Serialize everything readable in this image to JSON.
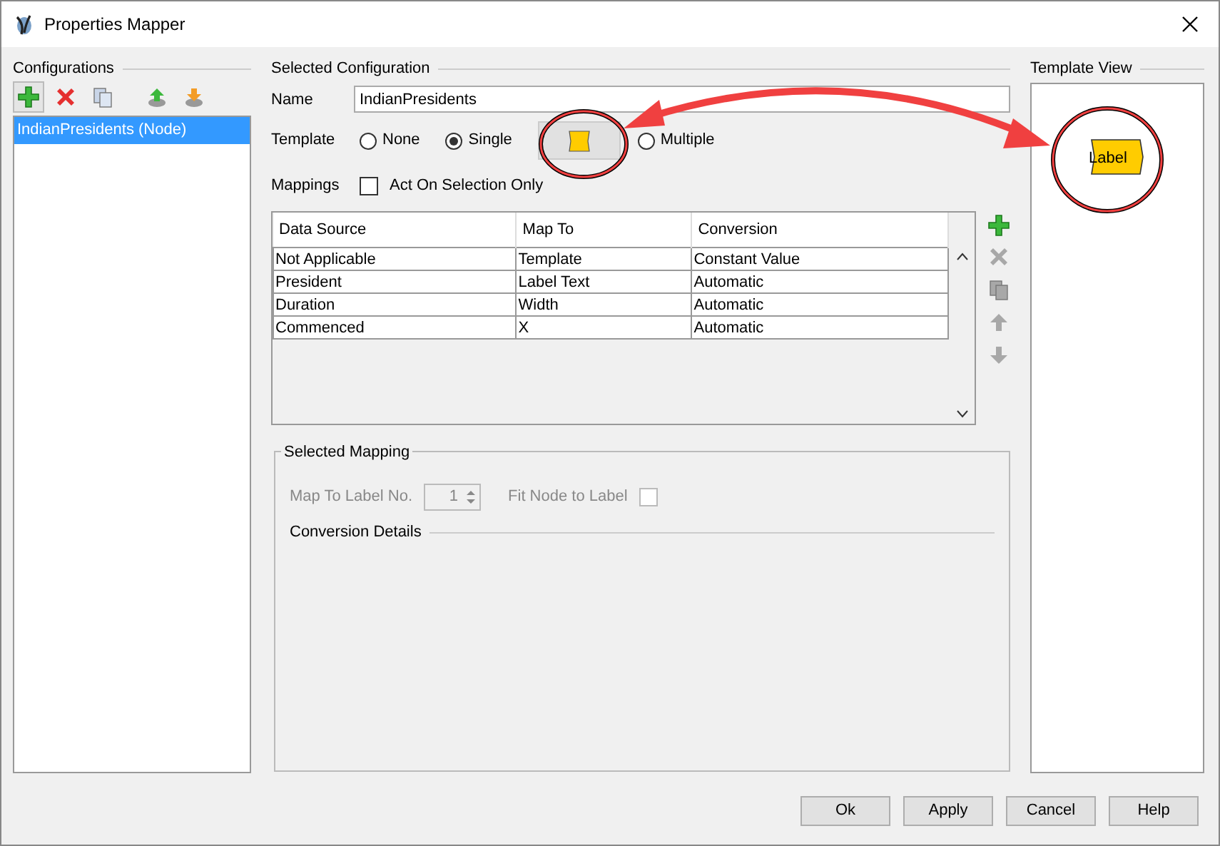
{
  "window": {
    "title": "Properties Mapper"
  },
  "configurations": {
    "title": "Configurations",
    "toolbar": [
      {
        "kind": "add",
        "hover": true
      },
      {
        "kind": "delete",
        "hover": false
      },
      {
        "kind": "copy",
        "hover": false
      },
      {
        "kind": "import",
        "hover": false
      },
      {
        "kind": "export",
        "hover": false
      }
    ],
    "items": [
      {
        "label": "IndianPresidents (Node)",
        "selected": true
      }
    ]
  },
  "selected_configuration": {
    "title": "Selected Configuration",
    "name_label": "Name",
    "name_value": "IndianPresidents",
    "template_label": "Template",
    "template_options": [
      {
        "label": "None",
        "selected": false
      },
      {
        "label": "Single",
        "selected": true
      },
      {
        "label": "Multiple",
        "selected": false
      }
    ],
    "mappings_label": "Mappings",
    "act_on_selection": {
      "label": "Act On Selection Only",
      "checked": false
    },
    "table": {
      "columns": [
        "Data Source",
        "Map To",
        "Conversion"
      ],
      "rows": [
        [
          "Not Applicable",
          "Template",
          "Constant Value"
        ],
        [
          "President",
          "Label Text",
          "Automatic"
        ],
        [
          "Duration",
          "Width",
          "Automatic"
        ],
        [
          "Commenced",
          "X",
          "Automatic"
        ]
      ]
    },
    "side_buttons": [
      {
        "kind": "add",
        "disabled": false
      },
      {
        "kind": "delete",
        "disabled": true
      },
      {
        "kind": "copy",
        "disabled": true
      },
      {
        "kind": "up",
        "disabled": true
      },
      {
        "kind": "down",
        "disabled": true
      }
    ]
  },
  "selected_mapping": {
    "title": "Selected Mapping",
    "disabled": true,
    "label_no_label": "Map To Label No.",
    "label_no_value": "1",
    "fit_label": "Fit Node to Label",
    "fit_checked": false,
    "conversion_details": "Conversion Details"
  },
  "template_view": {
    "title": "Template View",
    "label": "Label"
  },
  "buttons": [
    "Ok",
    "Apply",
    "Cancel",
    "Help"
  ]
}
